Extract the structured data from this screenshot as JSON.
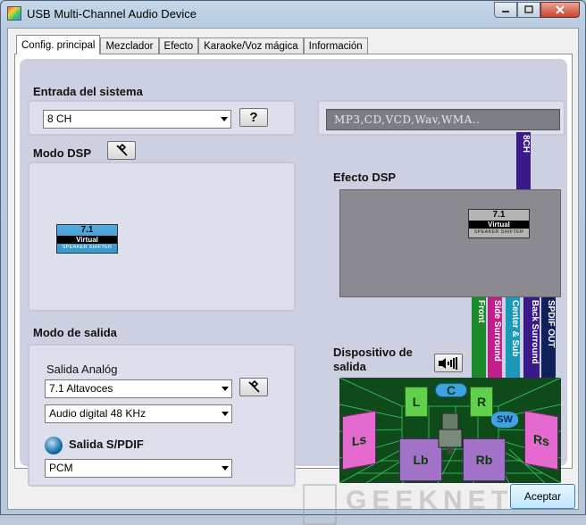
{
  "window": {
    "title": "USB Multi-Channel Audio Device"
  },
  "tabs": [
    {
      "label": "Config. principal"
    },
    {
      "label": "Mezclador"
    },
    {
      "label": "Efecto"
    },
    {
      "label": "Karaoke/Voz mágica"
    },
    {
      "label": "Información"
    }
  ],
  "input": {
    "header": "Entrada del sistema",
    "channels_value": "8 CH",
    "help_label": "?",
    "formats_display": "MP3,CD,VCD,Wav,WMA.."
  },
  "channel_bar": "8CH",
  "dsp": {
    "header": "Modo DSP",
    "effect_header": "Efecto DSP",
    "logo": {
      "line1": "7.1",
      "line2": "Virtual",
      "line3": "SPEAKER SHIFTER"
    }
  },
  "output": {
    "header": "Modo de salida",
    "analog_label": "Salida Analóg",
    "analog_value": "7.1 Altavoces",
    "digital_value": "Audio digital  48 KHz",
    "spdif_label": "Salida S/PDIF",
    "spdif_value": "PCM"
  },
  "device": {
    "header": "Dispositivo de salida",
    "channels": [
      {
        "label": "Front",
        "color": "#1a8a2a"
      },
      {
        "label": "Side Surround",
        "color": "#c0208a"
      },
      {
        "label": "Center & Sub",
        "color": "#1a9ab8"
      },
      {
        "label": "Back Surround",
        "color": "#3a1a8a"
      },
      {
        "label": "SPDIF OUT",
        "color": "#10205a"
      }
    ],
    "speakers": {
      "center": "C",
      "left": "L",
      "right": "R",
      "subwoofer": "SW",
      "left_side": "Ls",
      "right_side": "Rs",
      "left_back": "Lb",
      "right_back": "Rb"
    }
  },
  "footer": {
    "ok_label": "Aceptar",
    "watermark": "GEEKNETIC"
  }
}
